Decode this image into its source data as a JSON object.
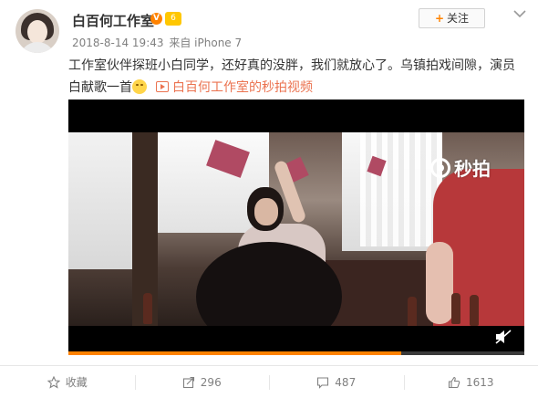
{
  "post": {
    "author": "白百何工作室",
    "verified_label": "V",
    "vip_label": "6",
    "timestamp": "2018-8-14 19:43",
    "source_prefix": "来自",
    "source": "iPhone 7",
    "follow_label": "关注",
    "text": "工作室伙伴探班小白同学，还好真的没胖，我们就放心了。乌镇拍戏间隙，演员白献歌一首",
    "video_link_label": "白百何工作室的秒拍视频"
  },
  "video": {
    "watermark": "秒拍",
    "progress_percent": 73
  },
  "actions": {
    "favorite_label": "收藏",
    "repost_count": "296",
    "comment_count": "487",
    "like_count": "1613"
  },
  "colors": {
    "accent_orange": "#ff8200",
    "link_orange": "#eb7350",
    "muted_gray": "#808080"
  }
}
